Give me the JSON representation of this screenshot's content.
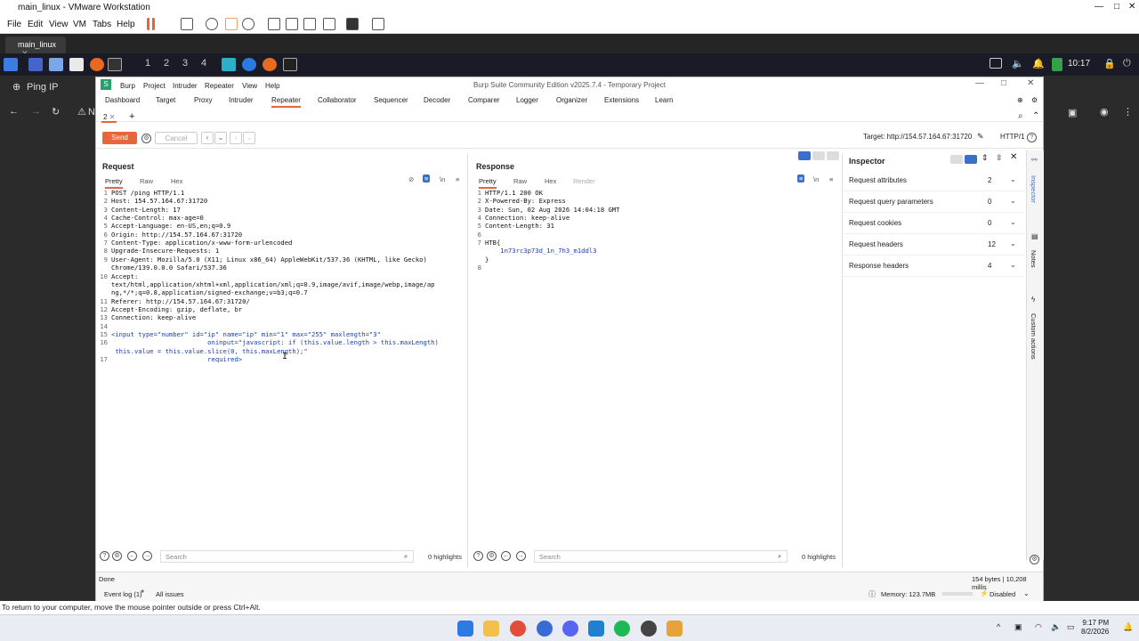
{
  "vmware": {
    "title": "main_linux - VMware Workstation",
    "menu": [
      "File",
      "Edit",
      "View",
      "VM",
      "Tabs",
      "Help"
    ],
    "tab": "main_linux",
    "hint": "To return to your computer, move the mouse pointer outside or press Ctrl+Alt."
  },
  "guest_panel": {
    "workspaces": [
      "1",
      "2",
      "3",
      "4"
    ],
    "clock": "10:17"
  },
  "bg_browser": {
    "tab_title": "Ping IP",
    "partial": "N"
  },
  "burp": {
    "title": "Burp Suite Community Edition v2025.7.4 - Temporary Project",
    "menu": [
      "Burp",
      "Project",
      "Intruder",
      "Repeater",
      "View",
      "Help"
    ],
    "tools": [
      "Dashboard",
      "Target",
      "Proxy",
      "Intruder",
      "Repeater",
      "Collaborator",
      "Sequencer",
      "Decoder",
      "Comparer",
      "Logger",
      "Organizer",
      "Extensions",
      "Learn"
    ],
    "active_tool": "Repeater",
    "repeater_tab": "2",
    "send_label": "Send",
    "cancel_label": "Cancel",
    "target_label": "Target: http://154.57.164.67:31720",
    "http_version": "HTTP/1",
    "request": {
      "title": "Request",
      "tabs": [
        "Pretty",
        "Raw",
        "Hex"
      ],
      "lines": [
        {
          "n": "1",
          "t": "POST /ping HTTP/1.1"
        },
        {
          "n": "2",
          "t": "Host: 154.57.164.67:31720"
        },
        {
          "n": "3",
          "t": "Content-Length: 17"
        },
        {
          "n": "4",
          "t": "Cache-Control: max-age=0"
        },
        {
          "n": "5",
          "t": "Accept-Language: en-US,en;q=0.9"
        },
        {
          "n": "6",
          "t": "Origin: http://154.57.164.67:31720"
        },
        {
          "n": "7",
          "t": "Content-Type: application/x-www-form-urlencoded"
        },
        {
          "n": "8",
          "t": "Upgrade-Insecure-Requests: 1"
        },
        {
          "n": "9",
          "t": "User-Agent: Mozilla/5.0 (X11; Linux x86_64) AppleWebKit/537.36 (KHTML, like Gecko)"
        },
        {
          "n": "",
          "t": "Chrome/139.0.0.0 Safari/537.36"
        },
        {
          "n": "10",
          "t": "Accept:"
        },
        {
          "n": "",
          "t": "text/html,application/xhtml+xml,application/xml;q=0.9,image/avif,image/webp,image/ap"
        },
        {
          "n": "",
          "t": "ng,*/*;q=0.8,application/signed-exchange;v=b3;q=0.7"
        },
        {
          "n": "11",
          "t": "Referer: http://154.57.164.67:31720/"
        },
        {
          "n": "12",
          "t": "Accept-Encoding: gzip, deflate, br"
        },
        {
          "n": "13",
          "t": "Connection: keep-alive"
        },
        {
          "n": "14",
          "t": ""
        },
        {
          "n": "15",
          "t": "<input type=\"number\" id=\"ip\" name=\"ip\" min=\"1\" max=\"255\" maxlength=\"3\""
        },
        {
          "n": "16",
          "t": "                         oninput=\"javascript: if (this.value.length > this.maxLength)"
        },
        {
          "n": "",
          "t": " this.value = this.value.slice(0, this.maxLength);\""
        },
        {
          "n": "17",
          "t": "                         required>"
        }
      ],
      "search_placeholder": "Search",
      "highlights": "0 highlights"
    },
    "response": {
      "title": "Response",
      "tabs": [
        "Pretty",
        "Raw",
        "Hex",
        "Render"
      ],
      "lines": [
        {
          "n": "1",
          "t": "HTTP/1.1 200 OK"
        },
        {
          "n": "2",
          "t": "X-Powered-By: Express"
        },
        {
          "n": "3",
          "t": "Date: Sun, 02 Aug 2026 14:04:18 GMT"
        },
        {
          "n": "4",
          "t": "Connection: keep-alive"
        },
        {
          "n": "5",
          "t": "Content-Length: 31"
        },
        {
          "n": "6",
          "t": ""
        },
        {
          "n": "7",
          "t": "HTB{"
        },
        {
          "n": "",
          "t": "    1n73rc3p73d_1n_7h3_m1ddl3"
        },
        {
          "n": "",
          "t": "}"
        },
        {
          "n": "8",
          "t": ""
        }
      ],
      "search_placeholder": "Search",
      "highlights": "0 highlights"
    },
    "inspector": {
      "title": "Inspector",
      "rows": [
        {
          "label": "Request attributes",
          "count": "2"
        },
        {
          "label": "Request query parameters",
          "count": "0"
        },
        {
          "label": "Request cookies",
          "count": "0"
        },
        {
          "label": "Request headers",
          "count": "12"
        },
        {
          "label": "Response headers",
          "count": "4"
        }
      ],
      "side_tabs": [
        "Inspector",
        "Notes",
        "Custom actions"
      ]
    },
    "status": {
      "done": "Done",
      "bytes": "154 bytes | 10,208 millis",
      "event_log": "Event log (1)",
      "all_issues": "All issues",
      "memory": "Memory: 123.7MB",
      "disabled": "Disabled"
    }
  },
  "taskbar": {
    "time": "9:17 PM",
    "date": "8/2/2026"
  }
}
